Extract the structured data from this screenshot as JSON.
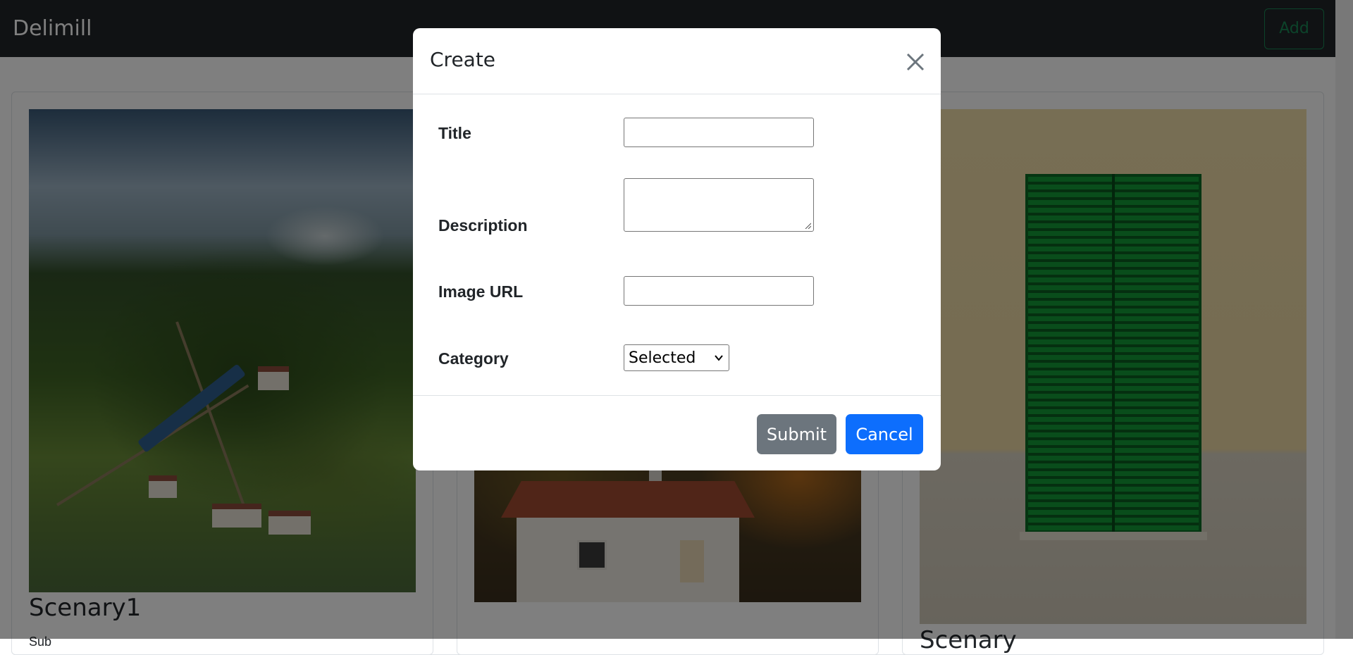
{
  "navbar": {
    "brand": "Delimill",
    "add_label": "Add"
  },
  "cards": [
    {
      "title": "Scenary1",
      "subtitle": "Sub"
    },
    {
      "title": "",
      "subtitle": ""
    },
    {
      "title": "Scenary",
      "subtitle": ""
    }
  ],
  "modal": {
    "title": "Create",
    "fields": {
      "title_label": "Title",
      "title_value": "",
      "description_label": "Description",
      "description_value": "",
      "image_url_label": "Image URL",
      "image_url_value": "",
      "category_label": "Category",
      "category_selected": "Selected"
    },
    "submit_label": "Submit",
    "cancel_label": "Cancel"
  },
  "colors": {
    "navbar_bg": "#212529",
    "add_outline": "#198754",
    "submit_bg": "#6c757d",
    "cancel_bg": "#0d6efd"
  }
}
